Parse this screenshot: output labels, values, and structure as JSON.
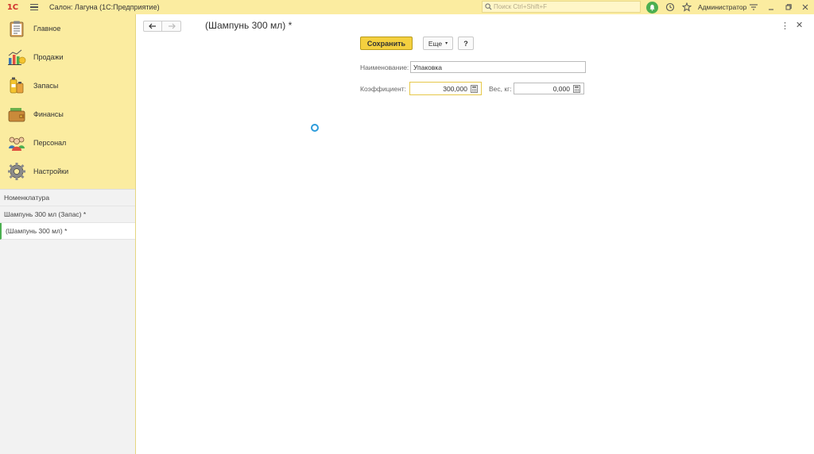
{
  "titlebar": {
    "logo": "1С",
    "app_title": "Салон: Лагуна  (1С:Предприятие)",
    "search_placeholder": "Поиск Ctrl+Shift+F",
    "user": "Администратор"
  },
  "sidebar": {
    "sections": [
      {
        "label": "Главное",
        "icon": "clipboard-icon"
      },
      {
        "label": "Продажи",
        "icon": "sales-chart-icon"
      },
      {
        "label": "Запасы",
        "icon": "stock-bottles-icon"
      },
      {
        "label": "Финансы",
        "icon": "wallet-icon"
      },
      {
        "label": "Персонал",
        "icon": "people-icon"
      },
      {
        "label": "Настройки",
        "icon": "gear-icon"
      }
    ],
    "open_windows": [
      {
        "label": "Номенклатура"
      },
      {
        "label": "Шампунь 300 мл (Запас) *"
      },
      {
        "label": "(Шампунь 300 мл) *"
      }
    ]
  },
  "form": {
    "title": "(Шампунь 300 мл) *",
    "save_label": "Сохранить",
    "more_label": "Еще",
    "help_label": "?",
    "name_label": "Наименование:",
    "name_value": "Упаковка",
    "coef_label": "Коэффициент:",
    "coef_value": "300,000",
    "weight_label": "Вес, кг:",
    "weight_value": "0,000"
  },
  "colors": {
    "accent_yellow": "#fbeca0",
    "save_button": "#f4d03f",
    "notify_green": "#4caf50",
    "spinner_blue": "#2d9cdb"
  }
}
